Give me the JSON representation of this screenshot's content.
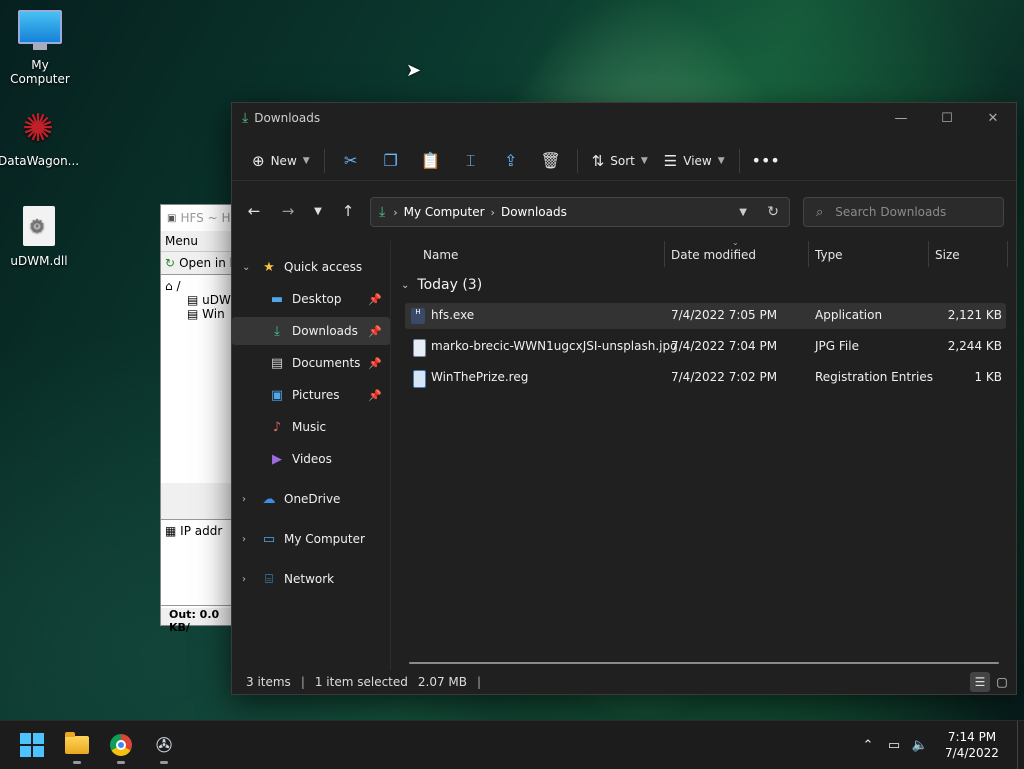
{
  "desktop": {
    "icons": [
      {
        "label": "My Computer"
      },
      {
        "label": "DataWagon..."
      },
      {
        "label": "uDWM.dll"
      }
    ]
  },
  "hfs_window": {
    "title": "HFS ~ H",
    "menu_label": "Menu",
    "open_label": "Open in b",
    "tree_root": "/",
    "tree_items": [
      "uDW",
      "Win"
    ],
    "log_text": "IP addr",
    "status_text": "Out: 0.0 KB/"
  },
  "explorer": {
    "title": "Downloads",
    "toolbar": {
      "new_label": "New",
      "sort_label": "Sort",
      "view_label": "View"
    },
    "address": {
      "crumbs": [
        "My Computer",
        "Downloads"
      ]
    },
    "search": {
      "placeholder": "Search Downloads"
    },
    "sidebar": {
      "quick_access": "Quick access",
      "items": [
        {
          "label": "Desktop"
        },
        {
          "label": "Downloads"
        },
        {
          "label": "Documents"
        },
        {
          "label": "Pictures"
        },
        {
          "label": "Music"
        },
        {
          "label": "Videos"
        }
      ],
      "roots": [
        {
          "label": "OneDrive"
        },
        {
          "label": "My Computer"
        },
        {
          "label": "Network"
        }
      ]
    },
    "columns": {
      "name": "Name",
      "date": "Date modified",
      "type": "Type",
      "size": "Size"
    },
    "group_label": "Today (3)",
    "files": [
      {
        "name": "hfs.exe",
        "date": "7/4/2022 7:05 PM",
        "type": "Application",
        "size": "2,121 KB"
      },
      {
        "name": "marko-brecic-WWN1ugcxJSI-unsplash.jpg",
        "date": "7/4/2022 7:04 PM",
        "type": "JPG File",
        "size": "2,244 KB"
      },
      {
        "name": "WinThePrize.reg",
        "date": "7/4/2022 7:02 PM",
        "type": "Registration Entries",
        "size": "1 KB"
      }
    ],
    "status": {
      "count": "3 items",
      "selected": "1 item selected",
      "selected_size": "2.07 MB"
    }
  },
  "taskbar": {
    "clock_time": "7:14 PM",
    "clock_date": "7/4/2022"
  },
  "colors": {
    "accent_blue": "#6ab7ff",
    "download_green": "#4cc38a",
    "window_bg": "#202020"
  }
}
